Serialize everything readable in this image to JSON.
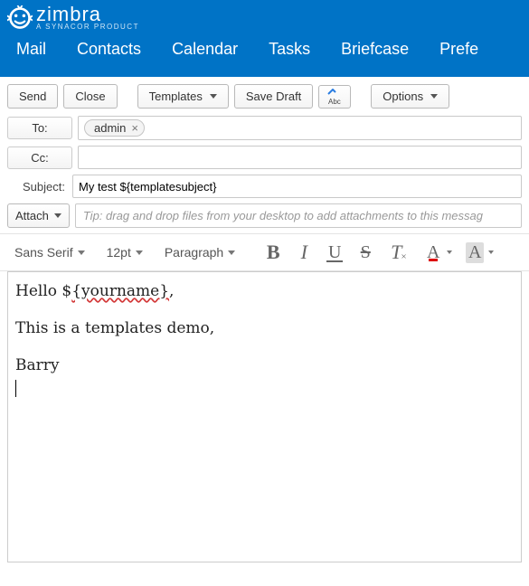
{
  "app": {
    "logo_text": "zimbra",
    "logo_subtext": "A SYNACOR PRODUCT"
  },
  "nav": {
    "mail": "Mail",
    "contacts": "Contacts",
    "calendar": "Calendar",
    "tasks": "Tasks",
    "briefcase": "Briefcase",
    "preferences": "Prefe"
  },
  "toolbar": {
    "send": "Send",
    "close": "Close",
    "templates": "Templates",
    "save_draft": "Save Draft",
    "options": "Options"
  },
  "compose": {
    "to_label": "To:",
    "to_chip": "admin",
    "cc_label": "Cc:",
    "subject_label": "Subject:",
    "subject_value": "My test ${templatesubject}",
    "attach_label": "Attach",
    "attach_hint": "Tip: drag and drop files from your desktop to add attachments to this messag"
  },
  "editor_toolbar": {
    "font_family": "Sans Serif",
    "font_size": "12pt",
    "paragraph": "Paragraph"
  },
  "body": {
    "line1_pre": "Hello $",
    "line1_wavy": "{yourname}",
    "line1_post": ",",
    "line2": "This is a templates demo,",
    "line3": "Barry"
  }
}
